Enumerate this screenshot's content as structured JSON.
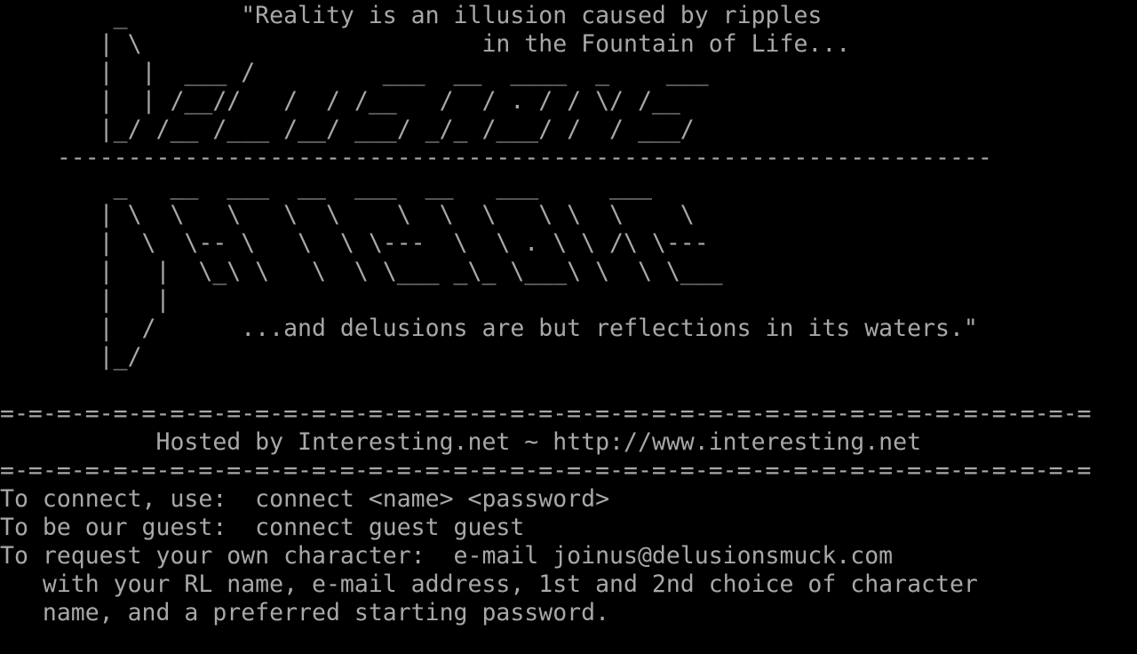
{
  "colors": {
    "background": "#000000",
    "text": "#a8a8a8"
  },
  "screen": {
    "lines": [
      "        _        \"Reality is an illusion caused by ripples",
      "       | \\                        in the Fountain of Life...",
      "       |  |  ___ /         ___  __  ____  _    ___",
      "       |  | /__//   /  / /__   /  / . / / \\/ /__",
      "       |_/ /__ /___ /__/ ___/ _/_ /___/ /  / ___/",
      "    ------------------------------------------------------------------",
      "        _   __  ___  __  ___  __   ___     ___",
      "       | \\  \\   \\   \\  \\    \\  \\  \\   \\ \\  \\    \\",
      "       |  \\  \\-- \\   \\  \\ \\---  \\  \\ . \\ \\ /\\ \\---",
      "       |   |  \\_\\ \\   \\  \\ \\___ _\\_ \\___\\ \\  \\ \\___",
      "       |   |",
      "       |  /      ...and delusions are but reflections in its waters.\"",
      "       |_/",
      "",
      "=-=-=-=-=-=-=-=-=-=-=-=-=-=-=-=-=-=-=-=-=-=-=-=-=-=-=-=-=-=-=-=-=-=-=-=-=-=-=",
      "           Hosted by Interesting.net ~ http://www.interesting.net",
      "=-=-=-=-=-=-=-=-=-=-=-=-=-=-=-=-=-=-=-=-=-=-=-=-=-=-=-=-=-=-=-=-=-=-=-=-=-=-=",
      "To connect, use:  connect <name> <password>",
      "To be our guest:  connect guest guest",
      "To request your own character:  e-mail joinus@delusionsmuck.com",
      "   with your RL name, e-mail address, 1st and 2nd choice of character",
      "   name, and a preferred starting password."
    ]
  }
}
